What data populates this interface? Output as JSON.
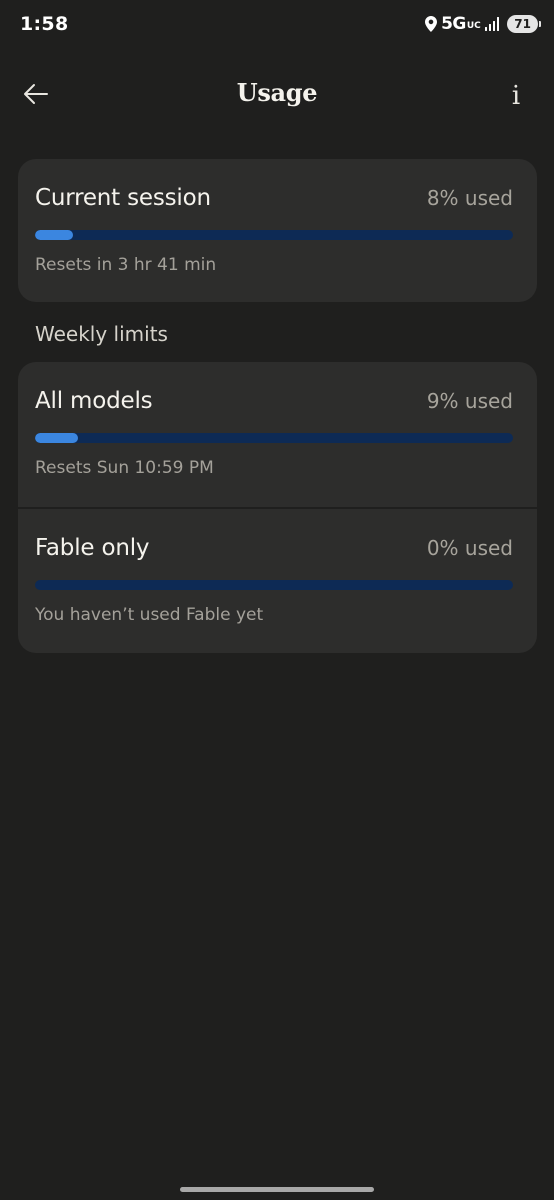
{
  "status_bar": {
    "time": "1:58",
    "network": "5G",
    "network_sub": "UC",
    "battery": "71"
  },
  "header": {
    "title": "Usage",
    "info_label": "i"
  },
  "session": {
    "title": "Current session",
    "used": "8% used",
    "progress_percent": 8,
    "subtitle": "Resets in 3 hr 41 min"
  },
  "weekly": {
    "label": "Weekly limits",
    "items": [
      {
        "title": "All models",
        "used": "9% used",
        "progress_percent": 9,
        "subtitle": "Resets Sun 10:59 PM"
      },
      {
        "title": "Fable only",
        "used": "0% used",
        "progress_percent": 0,
        "subtitle": "You haven’t used Fable yet"
      }
    ]
  },
  "colors": {
    "background": "#1f1f1e",
    "card": "#2d2d2c",
    "progress_track": "#0d2a55",
    "progress_fill": "#3b86e0"
  },
  "icons": {
    "back": "arrow-left-icon",
    "info": "info-icon",
    "location": "location-pin-icon",
    "signal": "signal-bars-icon"
  }
}
